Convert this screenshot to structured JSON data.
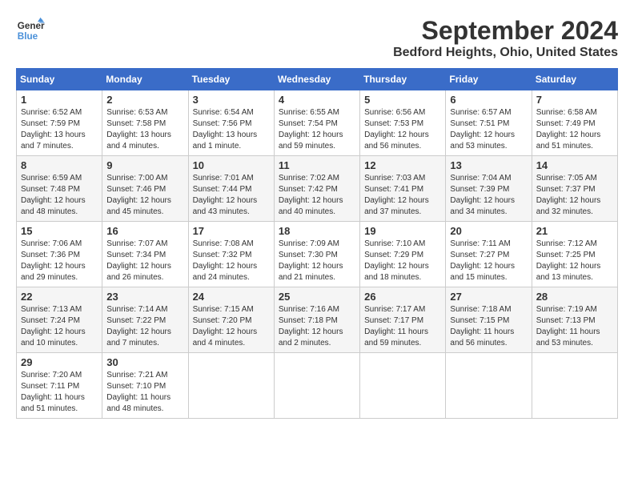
{
  "header": {
    "logo_line1": "General",
    "logo_line2": "Blue",
    "month": "September 2024",
    "location": "Bedford Heights, Ohio, United States"
  },
  "weekdays": [
    "Sunday",
    "Monday",
    "Tuesday",
    "Wednesday",
    "Thursday",
    "Friday",
    "Saturday"
  ],
  "weeks": [
    [
      {
        "day": "1",
        "info": "Sunrise: 6:52 AM\nSunset: 7:59 PM\nDaylight: 13 hours\nand 7 minutes."
      },
      {
        "day": "2",
        "info": "Sunrise: 6:53 AM\nSunset: 7:58 PM\nDaylight: 13 hours\nand 4 minutes."
      },
      {
        "day": "3",
        "info": "Sunrise: 6:54 AM\nSunset: 7:56 PM\nDaylight: 13 hours\nand 1 minute."
      },
      {
        "day": "4",
        "info": "Sunrise: 6:55 AM\nSunset: 7:54 PM\nDaylight: 12 hours\nand 59 minutes."
      },
      {
        "day": "5",
        "info": "Sunrise: 6:56 AM\nSunset: 7:53 PM\nDaylight: 12 hours\nand 56 minutes."
      },
      {
        "day": "6",
        "info": "Sunrise: 6:57 AM\nSunset: 7:51 PM\nDaylight: 12 hours\nand 53 minutes."
      },
      {
        "day": "7",
        "info": "Sunrise: 6:58 AM\nSunset: 7:49 PM\nDaylight: 12 hours\nand 51 minutes."
      }
    ],
    [
      {
        "day": "8",
        "info": "Sunrise: 6:59 AM\nSunset: 7:48 PM\nDaylight: 12 hours\nand 48 minutes."
      },
      {
        "day": "9",
        "info": "Sunrise: 7:00 AM\nSunset: 7:46 PM\nDaylight: 12 hours\nand 45 minutes."
      },
      {
        "day": "10",
        "info": "Sunrise: 7:01 AM\nSunset: 7:44 PM\nDaylight: 12 hours\nand 43 minutes."
      },
      {
        "day": "11",
        "info": "Sunrise: 7:02 AM\nSunset: 7:42 PM\nDaylight: 12 hours\nand 40 minutes."
      },
      {
        "day": "12",
        "info": "Sunrise: 7:03 AM\nSunset: 7:41 PM\nDaylight: 12 hours\nand 37 minutes."
      },
      {
        "day": "13",
        "info": "Sunrise: 7:04 AM\nSunset: 7:39 PM\nDaylight: 12 hours\nand 34 minutes."
      },
      {
        "day": "14",
        "info": "Sunrise: 7:05 AM\nSunset: 7:37 PM\nDaylight: 12 hours\nand 32 minutes."
      }
    ],
    [
      {
        "day": "15",
        "info": "Sunrise: 7:06 AM\nSunset: 7:36 PM\nDaylight: 12 hours\nand 29 minutes."
      },
      {
        "day": "16",
        "info": "Sunrise: 7:07 AM\nSunset: 7:34 PM\nDaylight: 12 hours\nand 26 minutes."
      },
      {
        "day": "17",
        "info": "Sunrise: 7:08 AM\nSunset: 7:32 PM\nDaylight: 12 hours\nand 24 minutes."
      },
      {
        "day": "18",
        "info": "Sunrise: 7:09 AM\nSunset: 7:30 PM\nDaylight: 12 hours\nand 21 minutes."
      },
      {
        "day": "19",
        "info": "Sunrise: 7:10 AM\nSunset: 7:29 PM\nDaylight: 12 hours\nand 18 minutes."
      },
      {
        "day": "20",
        "info": "Sunrise: 7:11 AM\nSunset: 7:27 PM\nDaylight: 12 hours\nand 15 minutes."
      },
      {
        "day": "21",
        "info": "Sunrise: 7:12 AM\nSunset: 7:25 PM\nDaylight: 12 hours\nand 13 minutes."
      }
    ],
    [
      {
        "day": "22",
        "info": "Sunrise: 7:13 AM\nSunset: 7:24 PM\nDaylight: 12 hours\nand 10 minutes."
      },
      {
        "day": "23",
        "info": "Sunrise: 7:14 AM\nSunset: 7:22 PM\nDaylight: 12 hours\nand 7 minutes."
      },
      {
        "day": "24",
        "info": "Sunrise: 7:15 AM\nSunset: 7:20 PM\nDaylight: 12 hours\nand 4 minutes."
      },
      {
        "day": "25",
        "info": "Sunrise: 7:16 AM\nSunset: 7:18 PM\nDaylight: 12 hours\nand 2 minutes."
      },
      {
        "day": "26",
        "info": "Sunrise: 7:17 AM\nSunset: 7:17 PM\nDaylight: 11 hours\nand 59 minutes."
      },
      {
        "day": "27",
        "info": "Sunrise: 7:18 AM\nSunset: 7:15 PM\nDaylight: 11 hours\nand 56 minutes."
      },
      {
        "day": "28",
        "info": "Sunrise: 7:19 AM\nSunset: 7:13 PM\nDaylight: 11 hours\nand 53 minutes."
      }
    ],
    [
      {
        "day": "29",
        "info": "Sunrise: 7:20 AM\nSunset: 7:11 PM\nDaylight: 11 hours\nand 51 minutes."
      },
      {
        "day": "30",
        "info": "Sunrise: 7:21 AM\nSunset: 7:10 PM\nDaylight: 11 hours\nand 48 minutes."
      },
      {
        "day": "",
        "info": ""
      },
      {
        "day": "",
        "info": ""
      },
      {
        "day": "",
        "info": ""
      },
      {
        "day": "",
        "info": ""
      },
      {
        "day": "",
        "info": ""
      }
    ]
  ]
}
